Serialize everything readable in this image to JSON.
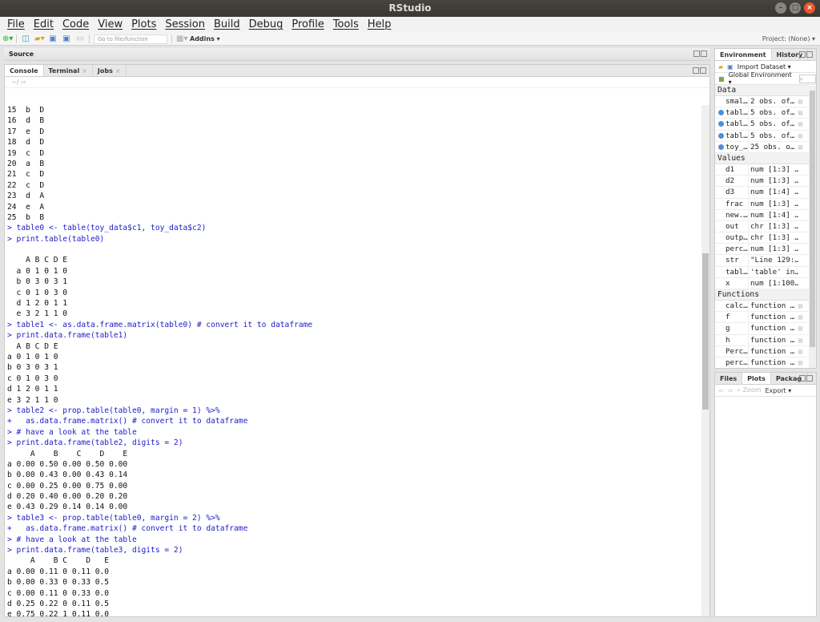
{
  "window": {
    "title": "RStudio",
    "minimize": "–",
    "maximize": "□",
    "close": "×"
  },
  "menu": [
    "File",
    "Edit",
    "Code",
    "View",
    "Plots",
    "Session",
    "Build",
    "Debug",
    "Profile",
    "Tools",
    "Help"
  ],
  "toolbar": {
    "goto_placeholder": "Go to file/function",
    "addins": "Addins ▾",
    "project": "Project: (None) ▾"
  },
  "source": {
    "title": "Source"
  },
  "console": {
    "tabs": [
      {
        "label": "Console",
        "active": true
      },
      {
        "label": "Terminal",
        "closable": true
      },
      {
        "label": "Jobs",
        "closable": true
      }
    ],
    "path": "~/ ⇨",
    "lines": [
      {
        "k": "out",
        "t": "15  b  D"
      },
      {
        "k": "out",
        "t": "16  d  B"
      },
      {
        "k": "out",
        "t": "17  e  D"
      },
      {
        "k": "out",
        "t": "18  d  D"
      },
      {
        "k": "out",
        "t": "19  c  D"
      },
      {
        "k": "out",
        "t": "20  a  B"
      },
      {
        "k": "out",
        "t": "21  c  D"
      },
      {
        "k": "out",
        "t": "22  c  D"
      },
      {
        "k": "out",
        "t": "23  d  A"
      },
      {
        "k": "out",
        "t": "24  e  A"
      },
      {
        "k": "out",
        "t": "25  b  B"
      },
      {
        "k": "in",
        "t": "> table0 <- table(toy_data$c1, toy_data$c2)"
      },
      {
        "k": "in",
        "t": "> print.table(table0)"
      },
      {
        "k": "out",
        "t": " "
      },
      {
        "k": "out",
        "t": "    A B C D E"
      },
      {
        "k": "out",
        "t": "  a 0 1 0 1 0"
      },
      {
        "k": "out",
        "t": "  b 0 3 0 3 1"
      },
      {
        "k": "out",
        "t": "  c 0 1 0 3 0"
      },
      {
        "k": "out",
        "t": "  d 1 2 0 1 1"
      },
      {
        "k": "out",
        "t": "  e 3 2 1 1 0"
      },
      {
        "k": "in",
        "t": "> table1 <- as.data.frame.matrix(table0) # convert it to dataframe"
      },
      {
        "k": "in",
        "t": "> print.data.frame(table1)"
      },
      {
        "k": "out",
        "t": "  A B C D E"
      },
      {
        "k": "out",
        "t": "a 0 1 0 1 0"
      },
      {
        "k": "out",
        "t": "b 0 3 0 3 1"
      },
      {
        "k": "out",
        "t": "c 0 1 0 3 0"
      },
      {
        "k": "out",
        "t": "d 1 2 0 1 1"
      },
      {
        "k": "out",
        "t": "e 3 2 1 1 0"
      },
      {
        "k": "in",
        "t": "> table2 <- prop.table(table0, margin = 1) %>%"
      },
      {
        "k": "in",
        "t": "+   as.data.frame.matrix() # convert it to dataframe"
      },
      {
        "k": "in",
        "t": "> # have a look at the table"
      },
      {
        "k": "in",
        "t": "> print.data.frame(table2, digits = 2)"
      },
      {
        "k": "out",
        "t": "     A    B    C    D    E"
      },
      {
        "k": "out",
        "t": "a 0.00 0.50 0.00 0.50 0.00"
      },
      {
        "k": "out",
        "t": "b 0.00 0.43 0.00 0.43 0.14"
      },
      {
        "k": "out",
        "t": "c 0.00 0.25 0.00 0.75 0.00"
      },
      {
        "k": "out",
        "t": "d 0.20 0.40 0.00 0.20 0.20"
      },
      {
        "k": "out",
        "t": "e 0.43 0.29 0.14 0.14 0.00"
      },
      {
        "k": "in",
        "t": "> table3 <- prop.table(table0, margin = 2) %>%"
      },
      {
        "k": "in",
        "t": "+   as.data.frame.matrix() # convert it to dataframe"
      },
      {
        "k": "in",
        "t": "> # have a look at the table"
      },
      {
        "k": "in",
        "t": "> print.data.frame(table3, digits = 2)"
      },
      {
        "k": "out",
        "t": "     A    B C    D   E"
      },
      {
        "k": "out",
        "t": "a 0.00 0.11 0 0.11 0.0"
      },
      {
        "k": "out",
        "t": "b 0.00 0.33 0 0.33 0.5"
      },
      {
        "k": "out",
        "t": "c 0.00 0.11 0 0.33 0.0"
      },
      {
        "k": "out",
        "t": "d 0.25 0.22 0 0.11 0.5"
      },
      {
        "k": "out",
        "t": "e 0.75 0.22 1 0.11 0.0"
      },
      {
        "k": "in",
        "t": "> "
      }
    ]
  },
  "environment": {
    "tabs": [
      "Environment",
      "History"
    ],
    "import": "Import Dataset ▾",
    "scope": "Global Environment ▾",
    "sections": [
      {
        "title": "Data",
        "rows": [
          {
            "name": "smal…",
            "value": "2 obs. of…",
            "dot": false,
            "grid": true
          },
          {
            "name": "tabl…",
            "value": "5 obs. of…",
            "dot": true,
            "grid": true
          },
          {
            "name": "tabl…",
            "value": "5 obs. of…",
            "dot": true,
            "grid": true
          },
          {
            "name": "tabl…",
            "value": "5 obs. of…",
            "dot": true,
            "grid": true
          },
          {
            "name": "toy_…",
            "value": "25 obs. o…",
            "dot": true,
            "grid": true
          }
        ]
      },
      {
        "title": "Values",
        "rows": [
          {
            "name": "d1",
            "value": "num [1:3] …"
          },
          {
            "name": "d2",
            "value": "num [1:3] …"
          },
          {
            "name": "d3",
            "value": "num [1:4] …"
          },
          {
            "name": "frac",
            "value": "num [1:3] …"
          },
          {
            "name": "new.…",
            "value": "num [1:4] …"
          },
          {
            "name": "out",
            "value": "chr [1:3] …"
          },
          {
            "name": "outp…",
            "value": "chr [1:3] …"
          },
          {
            "name": "perc…",
            "value": "num [1:3] …"
          },
          {
            "name": "str",
            "value": "\"Line 129:…"
          },
          {
            "name": "tabl…",
            "value": "'table' in…"
          },
          {
            "name": "x",
            "value": "num [1:100…"
          }
        ]
      },
      {
        "title": "Functions",
        "rows": [
          {
            "name": "calc…",
            "value": "function …",
            "grid": true
          },
          {
            "name": "f",
            "value": "function …",
            "grid": true
          },
          {
            "name": "g",
            "value": "function …",
            "grid": true
          },
          {
            "name": "h",
            "value": "function …",
            "grid": true
          },
          {
            "name": "Perc…",
            "value": "function …",
            "grid": true
          },
          {
            "name": "perc…",
            "value": "function …",
            "grid": true
          }
        ]
      }
    ]
  },
  "files": {
    "tabs": [
      "Files",
      "Plots",
      "Packag"
    ],
    "active": "Plots",
    "zoom": "Zoom",
    "export": "Export ▾"
  }
}
